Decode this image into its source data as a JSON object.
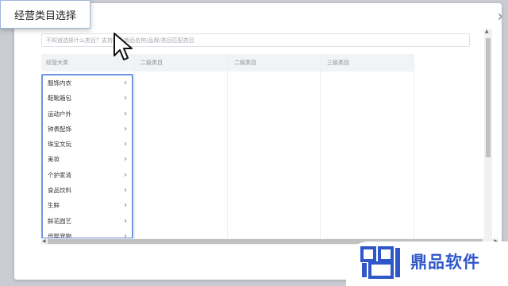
{
  "dialog": {
    "title": "经营类目选择",
    "close_icon": "close-icon"
  },
  "search": {
    "placeholder": "不知道选择什么类目？支持搜索商品名称/品牌/类目匹配类目"
  },
  "columns": {
    "headers": [
      "经营大类",
      "二级类目",
      "二级类目",
      "三级类目"
    ]
  },
  "categories": [
    {
      "label": "服饰内衣"
    },
    {
      "label": "鞋靴箱包"
    },
    {
      "label": "运动户外"
    },
    {
      "label": "钟表配饰"
    },
    {
      "label": "珠宝文玩"
    },
    {
      "label": "美妆"
    },
    {
      "label": "个护家清"
    },
    {
      "label": "食品饮料"
    },
    {
      "label": "生鲜"
    },
    {
      "label": "鲜花园艺"
    },
    {
      "label": "母婴宠物"
    }
  ],
  "brand": {
    "name": "鼎品软件",
    "color": "#2f57c9"
  },
  "colors": {
    "accent_border": "#6f95df",
    "header_bg": "#f2f3f5"
  }
}
